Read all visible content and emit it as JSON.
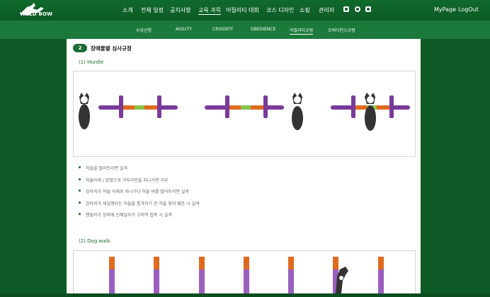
{
  "header": {
    "logo_text": "WALD BOW",
    "nav": [
      "소개",
      "전체 일정",
      "공지사항",
      "교육 과목",
      "어질리티 대회",
      "코스 디자인",
      "쇼핑",
      "관리자"
    ],
    "active_nav": "교육 과목",
    "social_icons": [
      "youtube-icon",
      "chat-icon",
      "instagram-icon"
    ],
    "mypage": "MyPage",
    "logout": "LogOut"
  },
  "subnav": {
    "items": [
      "수강신청",
      "AGILITY",
      "CROSSFIT",
      "OBEDIENCE",
      "어질리티규정",
      "오비디언스규정"
    ],
    "active": "어질리티규정"
  },
  "content": {
    "badge": "2",
    "title": "장애물별 심사규정",
    "hurdle_label": "(1) Hurdle",
    "rules": [
      "허들을 떨어트리면 실격",
      "허들아래 / 양옆으로 거부라인을 지나가면 거부",
      "강아지가 허들 아래로 지나가다 허들 바를 떨어트리면 실격",
      "강아지가 재실행되는 허들을 통과하기 전 허들 윙의 훼손 시 실격",
      "핸들러가 장비에 신체일부가 고의적 접촉 시 실격"
    ],
    "dogwalk_label": "(2) Dog walk"
  },
  "colors": {
    "header_green": "#0d5a26",
    "subnav_green": "#1b7a3b",
    "accent_green": "#1e6b34",
    "hurdle_purple": "#7a3a9a",
    "hurdle_orange": "#e06a20",
    "hurdle_green": "#8bc34a"
  }
}
